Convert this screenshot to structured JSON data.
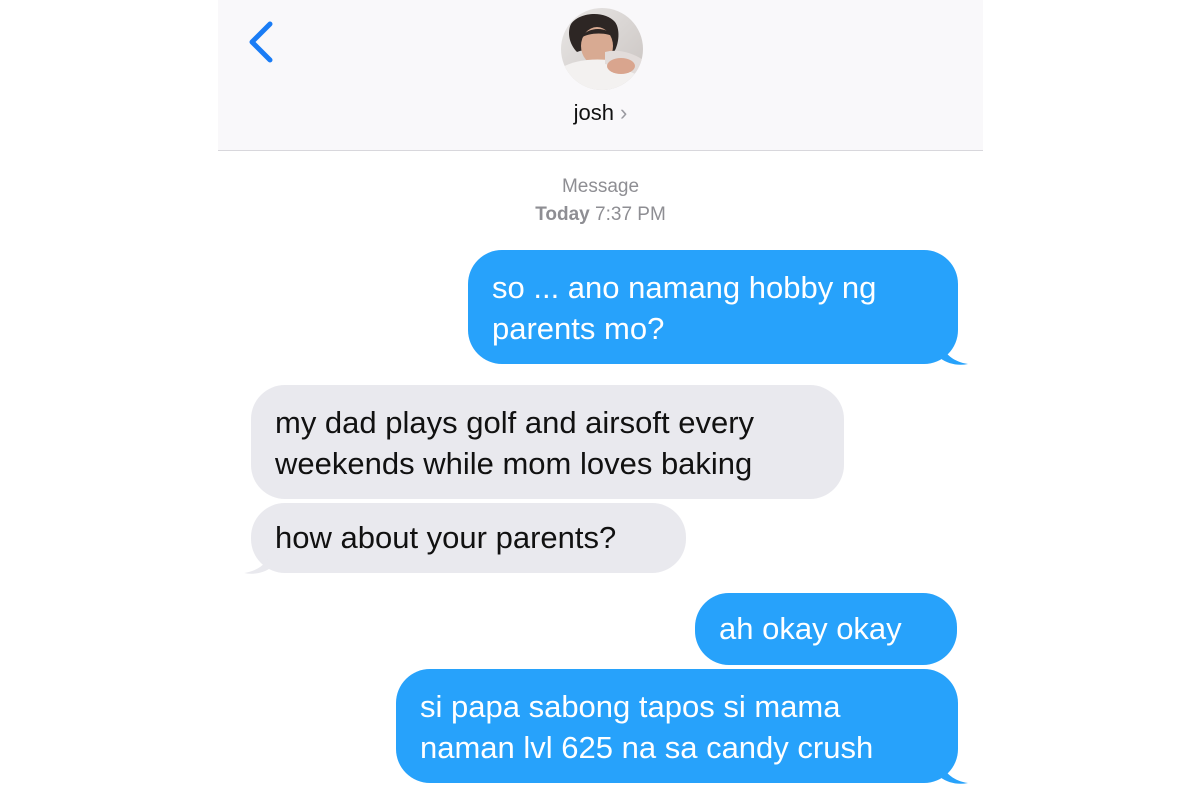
{
  "header": {
    "contact_name": "josh",
    "chevron": "›",
    "back_icon": "chevron-left-icon",
    "accent": "#1a7cf5"
  },
  "thread": {
    "service": "Message",
    "day": "Today",
    "time": "7:37 PM"
  },
  "messages": [
    {
      "direction": "outgoing",
      "lines": [
        "so ... ano namang hobby ng",
        "parents mo?"
      ]
    },
    {
      "direction": "incoming",
      "lines": [
        "my dad plays golf and airsoft every",
        "weekends while mom loves baking"
      ]
    },
    {
      "direction": "incoming",
      "lines": [
        "how about your parents?"
      ]
    },
    {
      "direction": "outgoing",
      "lines": [
        "ah okay okay"
      ]
    },
    {
      "direction": "outgoing",
      "lines": [
        "si papa sabong tapos si mama",
        "naman lvl 625 na sa candy crush"
      ]
    }
  ],
  "colors": {
    "outgoing_bubble": "#27a2fb",
    "incoming_bubble": "#e9e9ee",
    "header_bg": "#f9f8fa"
  }
}
